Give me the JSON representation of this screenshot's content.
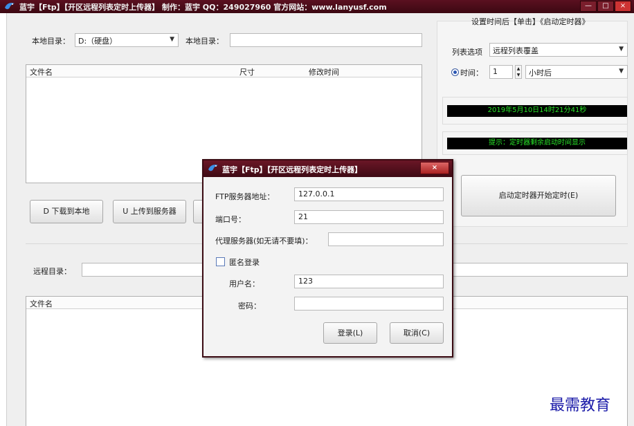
{
  "window": {
    "title": "蓝宇【Ftp】【开区远程列表定时上传器】 制作：蓝宇 QQ：249027960 官方网站：www.lanyusf.com",
    "buttons": [
      "—",
      "□",
      "×"
    ]
  },
  "local": {
    "dir_label": "本地目录：",
    "drive_value": "D:（硬盘）",
    "dir_label2": "本地目录：",
    "dir_value": ""
  },
  "local_list": {
    "columns": [
      "文件名",
      "尺寸",
      "修改时间"
    ]
  },
  "actions": {
    "download": "D 下载到本地",
    "upload": "U 上传到服务器"
  },
  "remote": {
    "dir_label": "远程目录：",
    "dir_value": "",
    "columns": [
      "文件名"
    ]
  },
  "timer_panel": {
    "header": "设置时间后【单击】《启动定时器》",
    "list_option_label": "列表选项",
    "list_option_value": "远程列表覆盖",
    "time_label": "时间：",
    "time_value": "1",
    "unit_value": "小时后",
    "clock": "2019年5月10日14时21分41秒",
    "hint": "提示：定时器剩余启动时间显示",
    "start_button": "启动定时器开始定时(E)"
  },
  "dialog": {
    "title": "蓝宇【Ftp】【开区远程列表定时上传器】",
    "close_label": "×",
    "server_label": "FTP服务器地址：",
    "server_value": "127.0.0.1",
    "port_label": "端口号：",
    "port_value": "21",
    "proxy_label": "代理服务器(如无请不要填)：",
    "proxy_value": "",
    "anon_label": "匿名登录",
    "user_label": "用户名：",
    "user_value": "123",
    "pass_label": "密码：",
    "pass_value": "",
    "login_button": "登录(L)",
    "cancel_button": "取消(C)"
  },
  "watermark": "最需教育"
}
